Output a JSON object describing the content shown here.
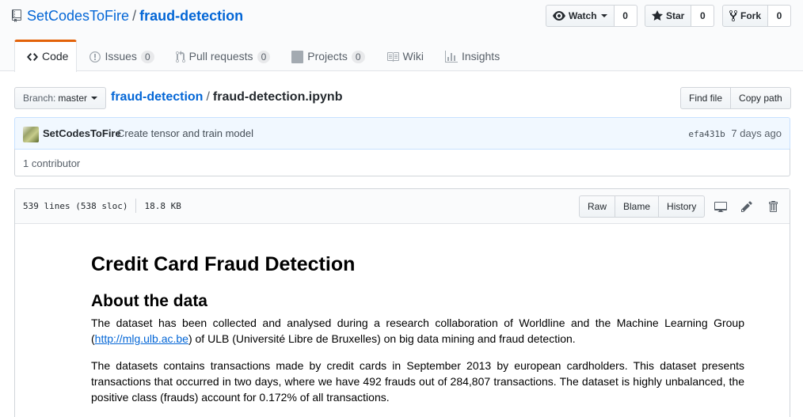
{
  "repo": {
    "owner": "SetCodesToFire",
    "separator": "/",
    "name": "fraud-detection"
  },
  "actions": {
    "watch_label": "Watch",
    "watch_count": "0",
    "star_label": "Star",
    "star_count": "0",
    "fork_label": "Fork",
    "fork_count": "0"
  },
  "tabs": [
    {
      "label": "Code",
      "icon": "code-icon"
    },
    {
      "label": "Issues",
      "count": "0",
      "icon": "issue-icon"
    },
    {
      "label": "Pull requests",
      "count": "0",
      "icon": "pull-request-icon"
    },
    {
      "label": "Projects",
      "count": "0",
      "icon": "project-icon"
    },
    {
      "label": "Wiki",
      "icon": "book-icon"
    },
    {
      "label": "Insights",
      "icon": "graph-icon"
    }
  ],
  "filenav": {
    "branch_prefix": "Branch:",
    "branch": "master",
    "crumb_repo": "fraud-detection",
    "crumb_sep": "/",
    "crumb_file": "fraud-detection.ipynb",
    "find_file": "Find file",
    "copy_path": "Copy path"
  },
  "commit": {
    "author": "SetCodesToFire",
    "message": "Create tensor and train model",
    "sha": "efa431b",
    "age": "7 days ago",
    "contributors": "1 contributor"
  },
  "file": {
    "lines": "539 lines (538 sloc)",
    "size": "18.8 KB",
    "raw": "Raw",
    "blame": "Blame",
    "history": "History"
  },
  "notebook": {
    "title": "Credit Card Fraud Detection",
    "heading": "About the data",
    "p1_a": "The dataset has been collected and analysed during a research collaboration of Worldline and the Machine Learning Group (",
    "p1_link": "http://mlg.ulb.ac.be",
    "p1_b": ") of ULB (Université Libre de Bruxelles) on big data mining and fraud detection.",
    "p2": "The datasets contains transactions made by credit cards in September 2013 by european cardholders. This dataset presents transactions that occurred in two days, where we have 492 frauds out of 284,807 transactions. The dataset is highly unbalanced, the positive class (frauds) account for 0.172% of all transactions."
  }
}
